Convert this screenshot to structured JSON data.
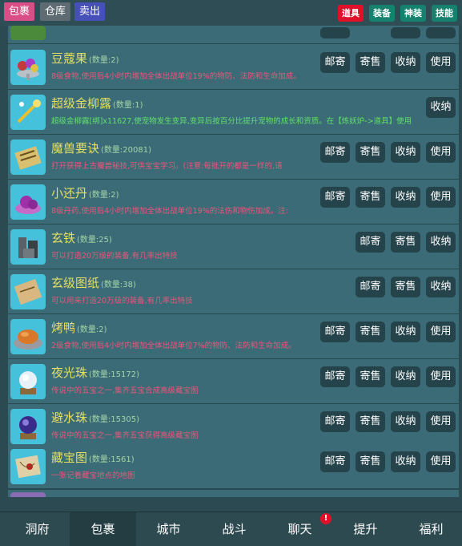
{
  "top_tabs": {
    "bag": "包裹",
    "warehouse": "仓库",
    "sell": "卖出"
  },
  "category_tabs": {
    "props": "道具",
    "equip": "装备",
    "divine": "神装",
    "skill": "技能"
  },
  "action_labels": {
    "mail": "邮寄",
    "consign": "寄售",
    "store": "收纳",
    "use": "使用"
  },
  "items": [
    {
      "name": "豆蔻果",
      "qty": "(数量:2)",
      "desc": "8级食物,使用后4小时内增加全体出战单位19%的物防、法防和生命加成。",
      "desc_color": "red",
      "icon": "fruit-bowl-icon",
      "buttons": [
        "mail",
        "consign",
        "store",
        "use"
      ]
    },
    {
      "name": "超级金柳露",
      "qty": "(数量:1)",
      "desc": "超级金柳露[绑]x11627,使宠物发生变异,变异后按百分比提升宠物的成长和资质。在【炼妖炉->道具】使用",
      "desc_color": "green",
      "icon": "golden-wand-icon",
      "buttons": [
        "store"
      ]
    },
    {
      "name": "魔兽要诀",
      "qty": "(数量:20081)",
      "desc": "打开获得上古魔兽秘技,可供宝宝学习。(注意:每批开的都是一样的,请",
      "desc_color": "red",
      "icon": "scroll-icon",
      "buttons": [
        "mail",
        "consign",
        "store",
        "use"
      ]
    },
    {
      "name": "小还丹",
      "qty": "(数量:2)",
      "desc": "8级丹药,使用后4小时内增加全体出战单位19%的法伤和物伤加成。注:",
      "desc_color": "red",
      "icon": "pill-icon",
      "buttons": [
        "mail",
        "consign",
        "store",
        "use"
      ]
    },
    {
      "name": "玄铁",
      "qty": "(数量:25)",
      "desc": "可以打造20万级的装备,有几率出特技",
      "desc_color": "red",
      "icon": "iron-ore-icon",
      "buttons": [
        "mail",
        "consign",
        "store"
      ]
    },
    {
      "name": "玄级图纸",
      "qty": "(数量:38)",
      "desc": "可以用来打造20万级的装备,有几率出特技",
      "desc_color": "red",
      "icon": "blueprint-icon",
      "buttons": [
        "mail",
        "consign",
        "store"
      ]
    },
    {
      "name": "烤鸭",
      "qty": "(数量:2)",
      "desc": "2级食物,使用后4小时内增加全体出战单位7%的物防、法防和生命加成。",
      "desc_color": "red",
      "icon": "roast-duck-icon",
      "buttons": [
        "mail",
        "consign",
        "store",
        "use"
      ]
    },
    {
      "name": "夜光珠",
      "qty": "(数量:15172)",
      "desc": "传说中的五宝之一,集齐五宝合成高级藏宝图",
      "desc_color": "red",
      "icon": "night-pearl-icon",
      "buttons": [
        "mail",
        "consign",
        "store",
        "use"
      ]
    },
    {
      "name": "避水珠",
      "qty": "(数量:15305)",
      "desc": "传说中的五宝之一,集齐五宝获得高级藏宝图",
      "desc_color": "red",
      "icon": "water-pearl-icon",
      "buttons": [
        "mail",
        "consign",
        "store",
        "use"
      ]
    },
    {
      "name": "藏宝图",
      "qty": "(数量:1561)",
      "desc": "一张记着藏宝地点的地图",
      "desc_color": "red",
      "icon": "treasure-map-icon",
      "buttons": [
        "mail",
        "consign",
        "store",
        "use"
      ]
    }
  ],
  "bottom_nav": [
    "洞府",
    "包裹",
    "城市",
    "战斗",
    "聊天",
    "提升",
    "福利"
  ],
  "bottom_nav_active": "包裹",
  "chat_badge": "!",
  "colors": {
    "item_name": "#e6df63",
    "desc_red": "#e8587a",
    "desc_green": "#61e06b",
    "row_bg": "#3a6b76",
    "button_bg": "#24434b"
  }
}
